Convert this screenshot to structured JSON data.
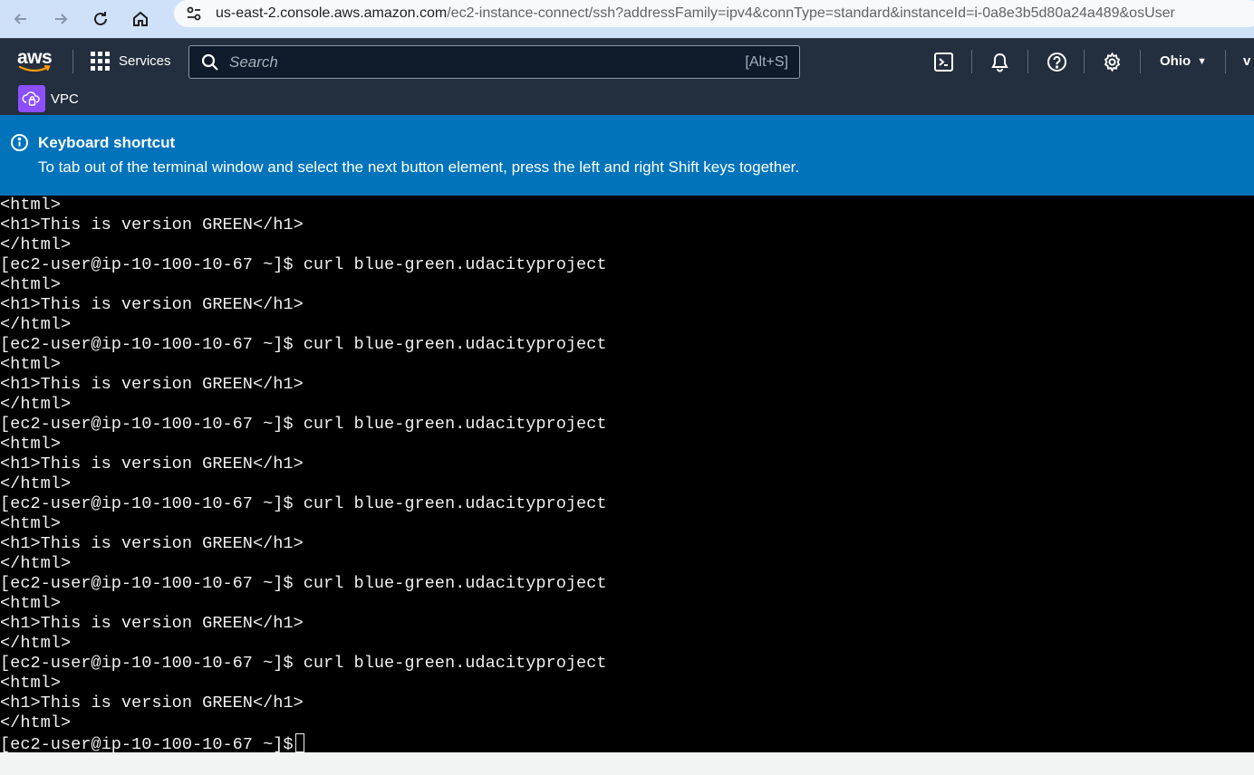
{
  "browser": {
    "url_host": "us-east-2.console.aws.amazon.com",
    "url_path": "/ec2-instance-connect/ssh?addressFamily=ipv4&connType=standard&instanceId=i-0a8e3b5d80a24a489&osUser"
  },
  "nav": {
    "logo_text": "aws",
    "services_label": "Services",
    "search_placeholder": "Search",
    "search_shortcut": "[Alt+S]",
    "region": "Ohio",
    "account_partial": "v"
  },
  "service_bar": {
    "service_name": "VPC"
  },
  "flash": {
    "title": "Keyboard shortcut",
    "message": "To tab out of the terminal window and select the next button element, press the left and right Shift keys together."
  },
  "terminal": {
    "lines": [
      "<html>",
      "<h1>This is version GREEN</h1>",
      "</html>",
      "[ec2-user@ip-10-100-10-67 ~]$ curl blue-green.udacityproject",
      "<html>",
      "<h1>This is version GREEN</h1>",
      "</html>",
      "[ec2-user@ip-10-100-10-67 ~]$ curl blue-green.udacityproject",
      "<html>",
      "<h1>This is version GREEN</h1>",
      "</html>",
      "[ec2-user@ip-10-100-10-67 ~]$ curl blue-green.udacityproject",
      "<html>",
      "<h1>This is version GREEN</h1>",
      "</html>",
      "[ec2-user@ip-10-100-10-67 ~]$ curl blue-green.udacityproject",
      "<html>",
      "<h1>This is version GREEN</h1>",
      "</html>",
      "[ec2-user@ip-10-100-10-67 ~]$ curl blue-green.udacityproject",
      "<html>",
      "<h1>This is version GREEN</h1>",
      "</html>",
      "[ec2-user@ip-10-100-10-67 ~]$ curl blue-green.udacityproject",
      "<html>",
      "<h1>This is version GREEN</h1>",
      "</html>"
    ],
    "prompt": "[ec2-user@ip-10-100-10-67 ~]$ "
  },
  "colors": {
    "nav_bg": "#232f3e",
    "flash_bg": "#0073bb",
    "vpc_icon_bg": "#8c4fff",
    "terminal_bg": "#000000"
  }
}
